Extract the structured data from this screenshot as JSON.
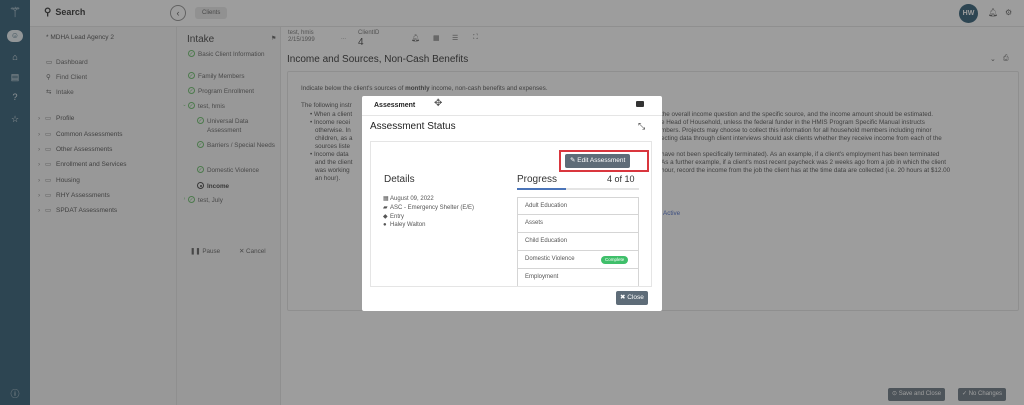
{
  "topbar": {
    "search_label": "Search",
    "clients_crumb": "Clients",
    "user_initials": "HW"
  },
  "sidebar": {
    "agency": "* MDHA Lead Agency 2",
    "links": [
      "Dashboard",
      "Find Client",
      "Intake"
    ],
    "folders": [
      "Profile",
      "Common Assessments",
      "Other Assessments",
      "Enrollment and Services",
      "Housing",
      "RHY Assessments",
      "SPDAT Assessments"
    ]
  },
  "intake": {
    "title": "Intake",
    "steps": {
      "basic": "Basic Client Information",
      "family": "Family Members",
      "program": "Program Enrollment",
      "test_hmis": "test, hmis",
      "universal": "Universal Data Assessment",
      "barriers": "Barriers / Special Needs",
      "domestic": "Domestic Violence",
      "income": "Income",
      "test_july": "test, July"
    },
    "pause_label": "Pause",
    "cancel_label": "Cancel"
  },
  "client": {
    "name": "test, hmis",
    "dob": "2/15/1999",
    "dots": "...",
    "id_label": "ClientID",
    "id_value": "4"
  },
  "main": {
    "title": "Income and Sources, Non-Cash Benefits",
    "intro_pre": "Indicate below the client's sources of ",
    "intro_bold": "monthly",
    "intro_post": " income, non-cash benefits and expenses.",
    "following": "The following instr",
    "lines": {
      "l1a": "When a client",
      "l1b": "the overall income question and the specific source, and the income amount should be estimated.",
      "l2a": "Income recei",
      "l2b": "e Head of Household, unless the federal funder in the HMIS Program Specific Manual instructs",
      "l3a": "otherwise. In",
      "l3b": "mbers.  Projects may choose to collect this information for all household members including minor",
      "l4a": "children, as a",
      "l4b": "ecting data through client interviews should ask clients whether they receive income from each of the",
      "l5a": "sources liste",
      "l6a": "Income data",
      "l6b": "have not been specifically terminated).  As an example, if a client's employment has been terminated",
      "l7a": "and the client",
      "l7b": "As a further example, if a client's most recent paycheck was 2 weeks ago from a job in which the client",
      "l8a": "was working",
      "l8b": "hour, record the income from the job the client has at the time data are collected (i.e. 20 hours at $12.00",
      "l9a": "an hour).",
      "active": "Active"
    }
  },
  "modal": {
    "header": "Assessment",
    "status_title": "Assessment Status",
    "edit_label": "Edit Assessment",
    "details_heading": "Details",
    "date": "August 09, 2022",
    "program": "ASC - Emergency Shelter (E/E)",
    "type": "Entry",
    "staff": "Haley Walton",
    "progress_heading": "Progress",
    "progress_count": "4 of 10",
    "progress_fraction": 0.4,
    "items": [
      {
        "label": "Adult Education",
        "badge": ""
      },
      {
        "label": "Assets",
        "badge": ""
      },
      {
        "label": "Child Education",
        "badge": ""
      },
      {
        "label": "Domestic Violence",
        "badge": "Complete"
      },
      {
        "label": "Employment",
        "badge": ""
      }
    ],
    "close_label": "Close"
  },
  "footer": {
    "save_close": "Save and Close",
    "no_changes": "No Changes"
  }
}
